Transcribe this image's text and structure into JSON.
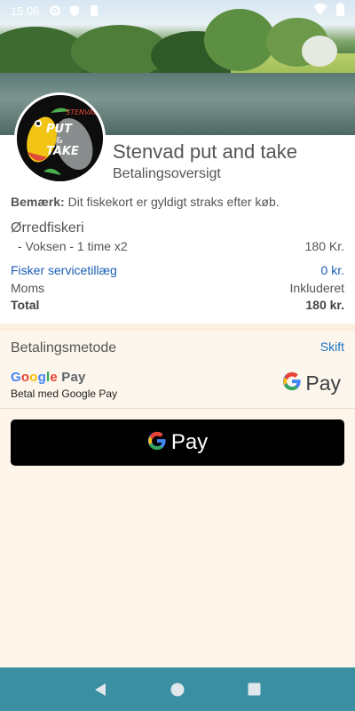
{
  "status_bar": {
    "time": "15.06"
  },
  "header": {
    "shop_name": "Stenvad put and take",
    "subtitle": "Betalingsoversigt",
    "logo_text": {
      "line1": "STENVAD",
      "line2": "PUT",
      "line3": "&",
      "line4": "TAKE"
    }
  },
  "notice": {
    "label": "Bemærk:",
    "text": " Dit fiskekort er gyldigt straks efter køb."
  },
  "order": {
    "section_title": "Ørredfiskeri",
    "line_item": {
      "label": "- Voksen - 1 time x2",
      "amount": "180 Kr."
    },
    "service_fee": {
      "label": "Fisker servicetillæg",
      "amount": "0 kr."
    },
    "vat": {
      "label": "Moms",
      "value": "Inkluderet"
    },
    "total": {
      "label": "Total",
      "amount": "180 kr."
    }
  },
  "payment": {
    "title": "Betalingsmetode",
    "change_label": "Skift",
    "brand": {
      "g": "G",
      "o1": "o",
      "o2": "o",
      "g2": "g",
      "l": "l",
      "e": "e",
      "pay": " Pay"
    },
    "description": "Betal med Google Pay",
    "mark_text": "Pay",
    "button_text": "Pay"
  },
  "colors": {
    "accent_blue": "#1a5fb4",
    "nav_bar": "#3a8fa3",
    "background": "#fdf5ea"
  }
}
